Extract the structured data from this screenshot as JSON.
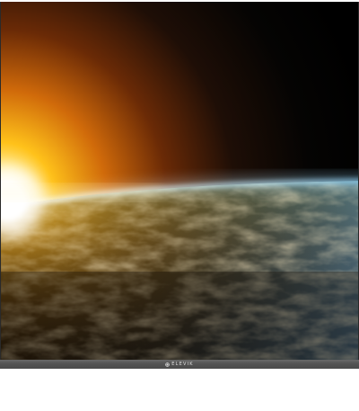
{
  "monitor": {
    "brand_label": "ELEVIK",
    "brand_icon": "diamond-logo-icon",
    "colors": {
      "bezel": "#555555",
      "brand_text": "#dcdcdc",
      "screen_bg": "#000000"
    }
  },
  "wallpaper": {
    "subject": "sunrise-over-earth",
    "colors": {
      "sun_core": "#ffffff",
      "sun_glow": "#ffb000",
      "atmosphere": "#bfe8ff",
      "ocean": "#2f5f86",
      "land": "#8a6a1f",
      "space": "#000000"
    }
  }
}
